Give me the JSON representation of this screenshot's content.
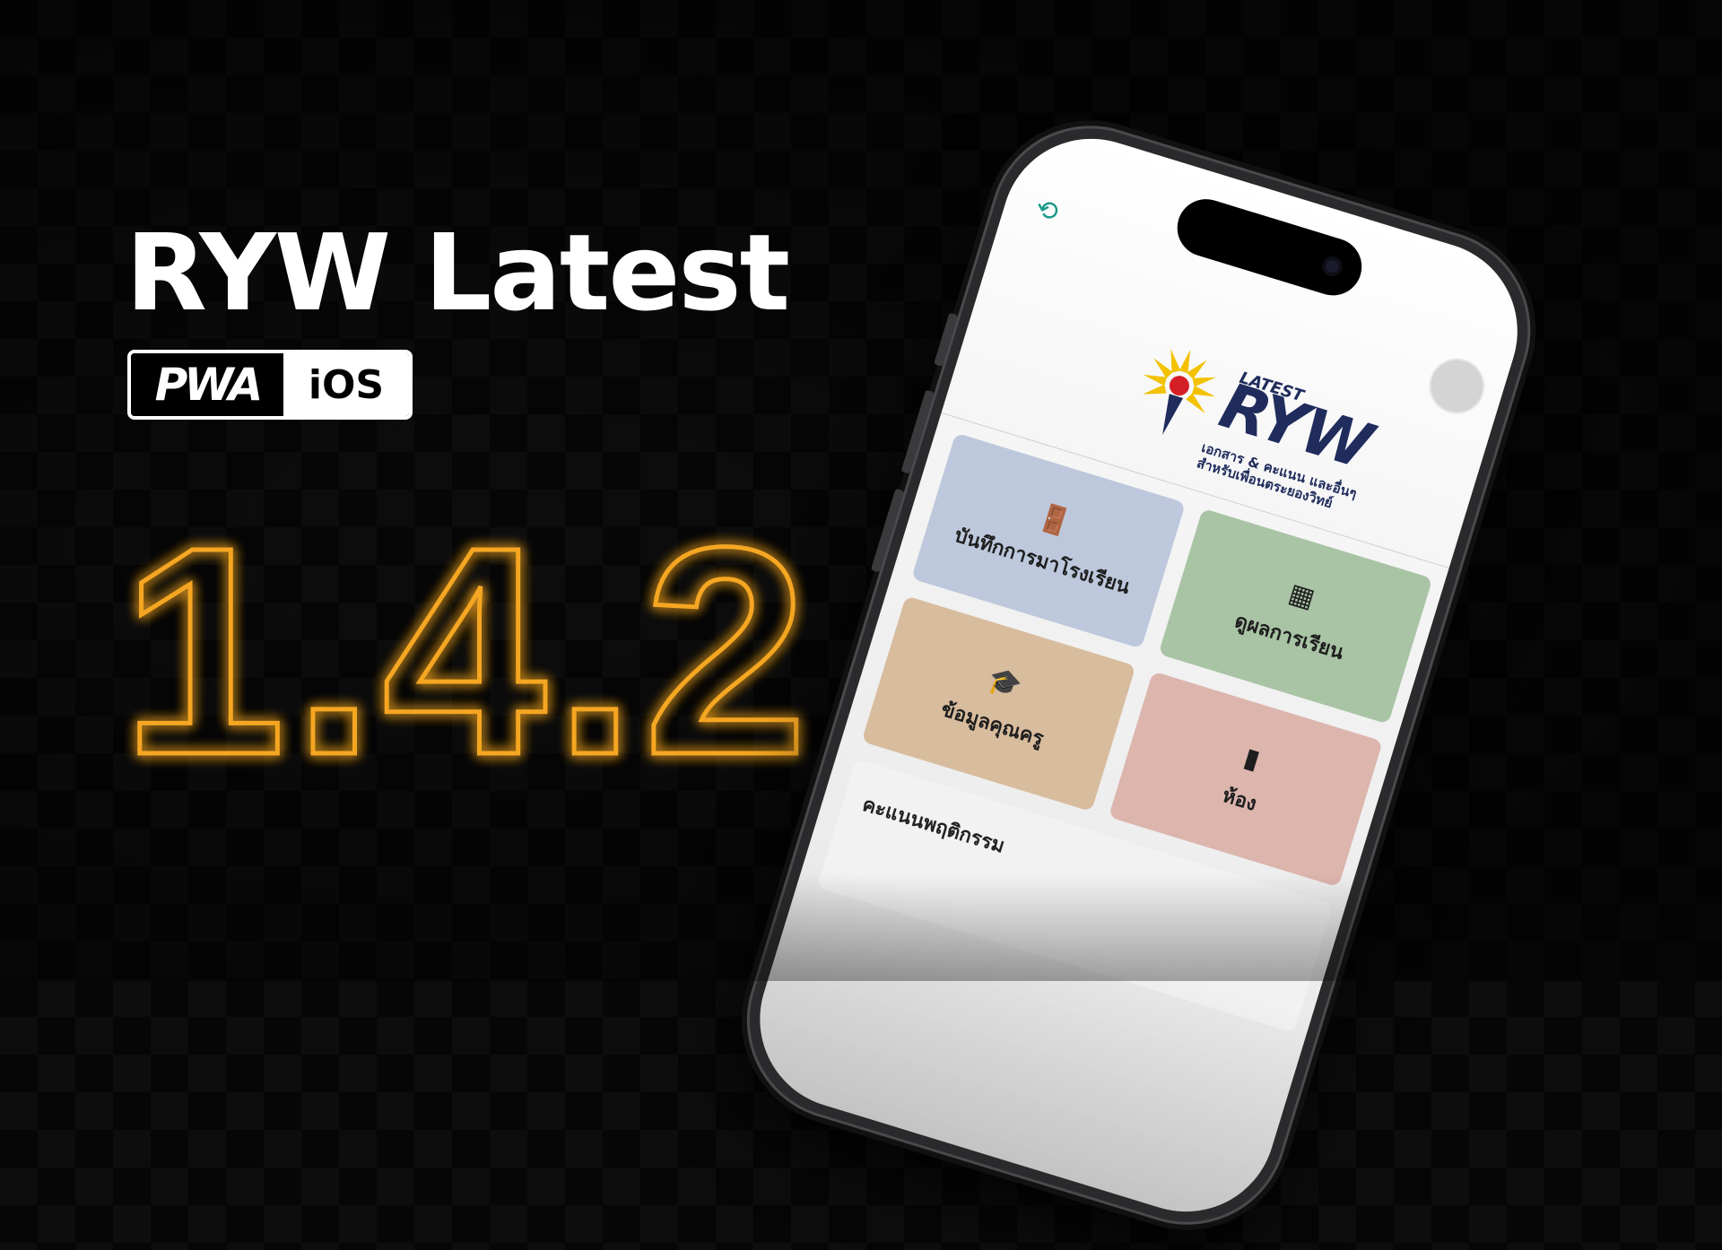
{
  "hero": {
    "title": "RYW Latest",
    "badge_left": "PWA",
    "badge_right": "iOS",
    "version": "1.4.2",
    "version_color": "#f5a623"
  },
  "app": {
    "top_icon": "refresh-user-icon",
    "logo": {
      "small": "LATEST",
      "main": "RYW",
      "sub_line1": "เอกสาร & คะแนน และอื่นๆ",
      "sub_line2": "สำหรับเพื่อนตระยองวิทย์"
    },
    "cards": [
      {
        "label": "บันทึกการมาโรงเรียน",
        "icon": "door-icon",
        "glyph": "🚪",
        "color": "#bdc8dc"
      },
      {
        "label": "ดูผลการเรียน",
        "icon": "scoreboard-icon",
        "glyph": "▦",
        "color": "#a9c4a5"
      },
      {
        "label": "ข้อมูลคุณครู",
        "icon": "graduation-cap-icon",
        "glyph": "🎓",
        "color": "#d8bc9e"
      },
      {
        "label": "ห้อง",
        "icon": "door-closed-icon",
        "glyph": "▮",
        "color": "#dcb5ad"
      }
    ],
    "behavior_label": "คะแนนพฤติกรรม"
  }
}
